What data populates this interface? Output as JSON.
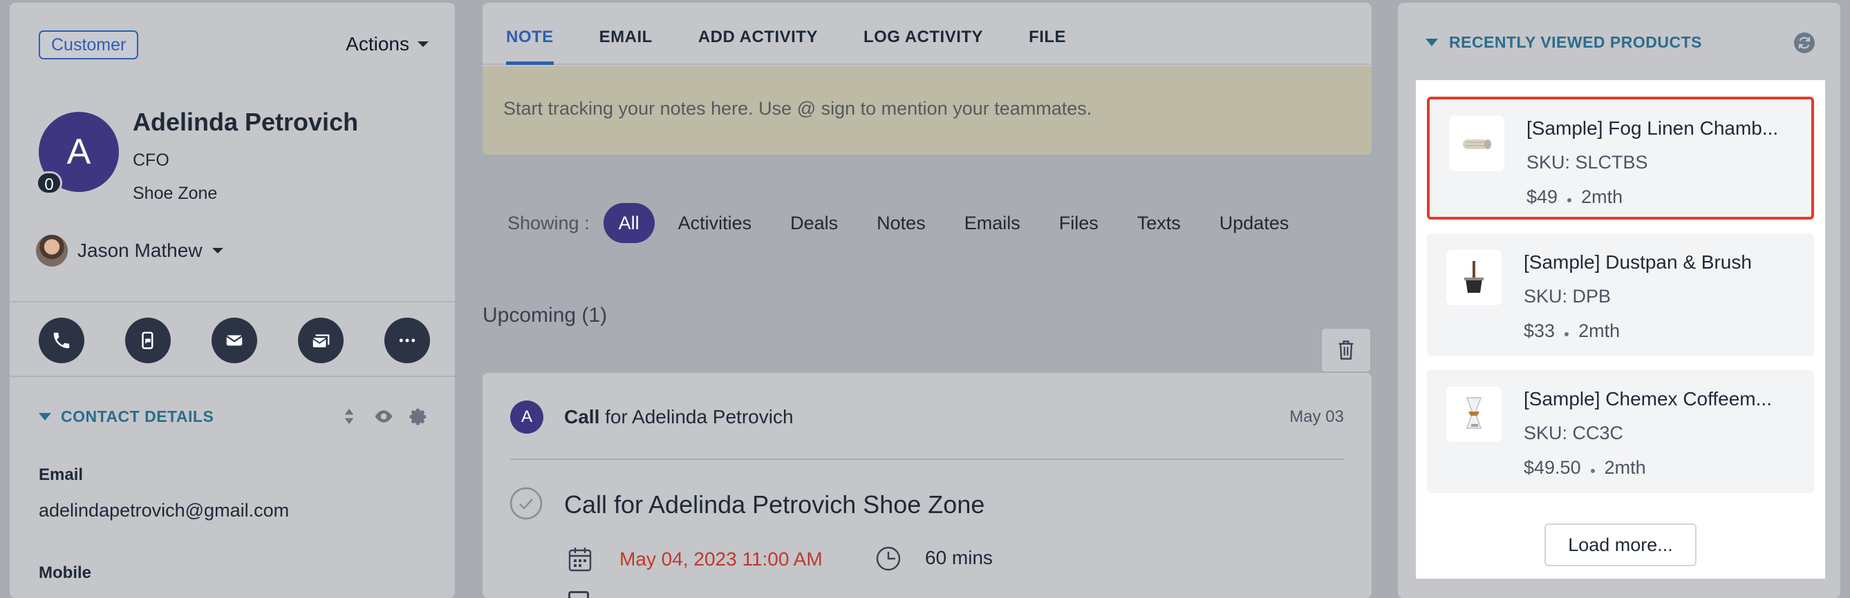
{
  "contact": {
    "badge": "Customer",
    "actions_label": "Actions",
    "avatar_initial": "A",
    "avatar_count": "0",
    "name": "Adelinda Petrovich",
    "role": "CFO",
    "company": "Shoe Zone",
    "owner": "Jason Mathew"
  },
  "quick_actions": [
    "phone-icon",
    "sms-icon",
    "email-icon",
    "sequence-icon",
    "more-icon"
  ],
  "contact_details": {
    "title": "CONTACT DETAILS",
    "email_label": "Email",
    "email_value": "adelindapetrovich@gmail.com",
    "mobile_label": "Mobile"
  },
  "composer": {
    "tabs": [
      "NOTE",
      "EMAIL",
      "ADD ACTIVITY",
      "LOG ACTIVITY",
      "FILE"
    ],
    "active_tab": "NOTE",
    "placeholder": "Start tracking your notes here. Use @ sign to mention your teammates."
  },
  "filters": {
    "label": "Showing :",
    "active": "All",
    "items": [
      "Activities",
      "Deals",
      "Notes",
      "Emails",
      "Files",
      "Texts",
      "Updates"
    ]
  },
  "upcoming": {
    "title": "Upcoming (1)",
    "card": {
      "avatar_initial": "A",
      "type": "Call",
      "for_text": "for Adelinda Petrovich",
      "date": "May 03",
      "subject": "Call for Adelinda Petrovich Shoe Zone",
      "when": "May 04, 2023 11:00 AM",
      "duration": "60 mins"
    }
  },
  "recently_viewed": {
    "title": "RECENTLY VIEWED PRODUCTS",
    "products": [
      {
        "name": "[Sample] Fog Linen Chamb...",
        "sku": "SKU: SLCTBS",
        "price": "$49",
        "age": "2mth"
      },
      {
        "name": "[Sample] Dustpan & Brush",
        "sku": "SKU: DPB",
        "price": "$33",
        "age": "2mth"
      },
      {
        "name": "[Sample] Chemex Coffeem...",
        "sku": "SKU: CC3C",
        "price": "$49.50",
        "age": "2mth"
      }
    ],
    "load_more": "Load more..."
  },
  "colors": {
    "accent": "#2f5fae",
    "avatar": "#3e3680",
    "section_heading": "#2c6c8c",
    "highlight_border": "#e23b28",
    "due_date": "#c0392b"
  }
}
